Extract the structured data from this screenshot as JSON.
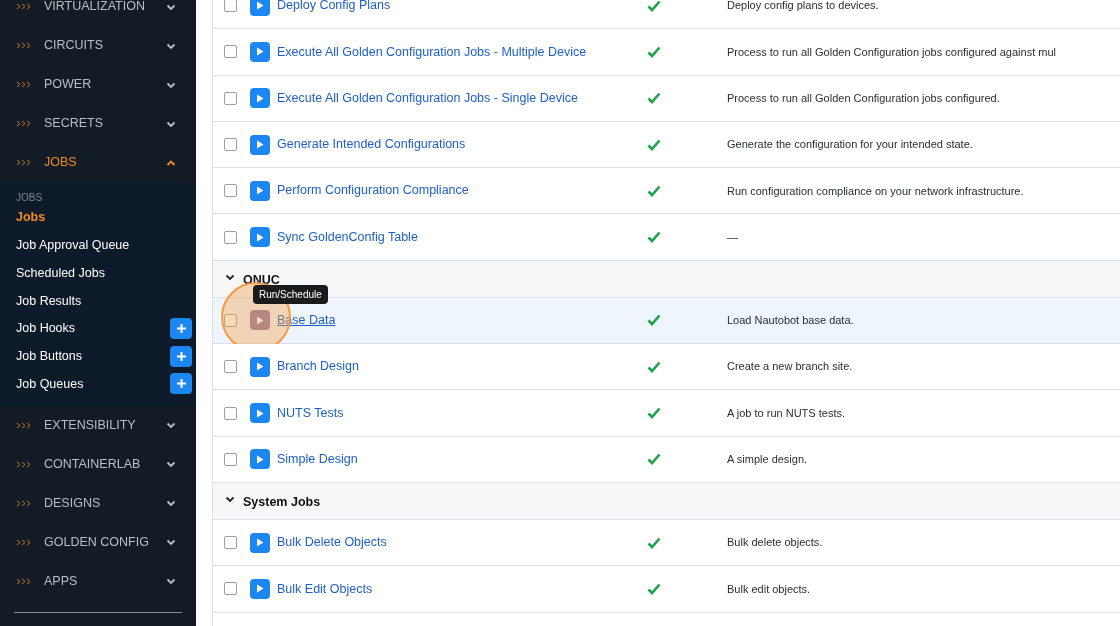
{
  "sidebar": {
    "sections": [
      {
        "label": "VIRTUALIZATION",
        "expanded": false
      },
      {
        "label": "CIRCUITS",
        "expanded": false
      },
      {
        "label": "POWER",
        "expanded": false
      },
      {
        "label": "SECRETS",
        "expanded": false
      },
      {
        "label": "JOBS",
        "expanded": true,
        "heading": "JOBS",
        "items": [
          {
            "label": "Jobs",
            "selected": true,
            "add_button": false
          },
          {
            "label": "Job Approval Queue",
            "selected": false,
            "add_button": false
          },
          {
            "label": "Scheduled Jobs",
            "selected": false,
            "add_button": false
          },
          {
            "label": "Job Results",
            "selected": false,
            "add_button": false
          },
          {
            "label": "Job Hooks",
            "selected": false,
            "add_button": true
          },
          {
            "label": "Job Buttons",
            "selected": false,
            "add_button": true
          },
          {
            "label": "Job Queues",
            "selected": false,
            "add_button": true
          }
        ]
      },
      {
        "label": "EXTENSIBILITY",
        "expanded": false
      },
      {
        "label": "CONTAINERLAB",
        "expanded": false
      },
      {
        "label": "DESIGNS",
        "expanded": false
      },
      {
        "label": "GOLDEN CONFIG",
        "expanded": false
      },
      {
        "label": "APPS",
        "expanded": false
      }
    ]
  },
  "table": {
    "rows": [
      {
        "kind": "job",
        "name": "Deploy Config Plans",
        "installed": true,
        "description": "Deploy config plans to devices.",
        "hovered": false
      },
      {
        "kind": "job",
        "name": "Execute All Golden Configuration Jobs - Multiple Device",
        "installed": true,
        "description": "Process to run all Golden Configuration jobs configured against mul",
        "hovered": false
      },
      {
        "kind": "job",
        "name": "Execute All Golden Configuration Jobs - Single Device",
        "installed": true,
        "description": "Process to run all Golden Configuration jobs configured.",
        "hovered": false
      },
      {
        "kind": "job",
        "name": "Generate Intended Configurations",
        "installed": true,
        "description": "Generate the configuration for your intended state.",
        "hovered": false
      },
      {
        "kind": "job",
        "name": "Perform Configuration Compliance",
        "installed": true,
        "description": "Run configuration compliance on your network infrastructure.",
        "hovered": false
      },
      {
        "kind": "job",
        "name": "Sync GoldenConfig Table",
        "installed": true,
        "description": "—",
        "hovered": false
      },
      {
        "kind": "group",
        "name": "ONUC",
        "expanded": true
      },
      {
        "kind": "job",
        "name": "Base Data",
        "installed": true,
        "description": "Load Nautobot base data.",
        "hovered": true,
        "tooltip": "Run/Schedule"
      },
      {
        "kind": "job",
        "name": "Branch Design",
        "installed": true,
        "description": "Create a new branch site.",
        "hovered": false
      },
      {
        "kind": "job",
        "name": "NUTS Tests",
        "installed": true,
        "description": "A job to run NUTS tests.",
        "hovered": false
      },
      {
        "kind": "job",
        "name": "Simple Design",
        "installed": true,
        "description": "A simple design.",
        "hovered": false
      },
      {
        "kind": "group",
        "name": "System Jobs",
        "expanded": true
      },
      {
        "kind": "job",
        "name": "Bulk Delete Objects",
        "installed": true,
        "description": "Bulk delete objects.",
        "hovered": false
      },
      {
        "kind": "job",
        "name": "Bulk Edit Objects",
        "installed": true,
        "description": "Bulk edit objects.",
        "hovered": false
      }
    ]
  }
}
